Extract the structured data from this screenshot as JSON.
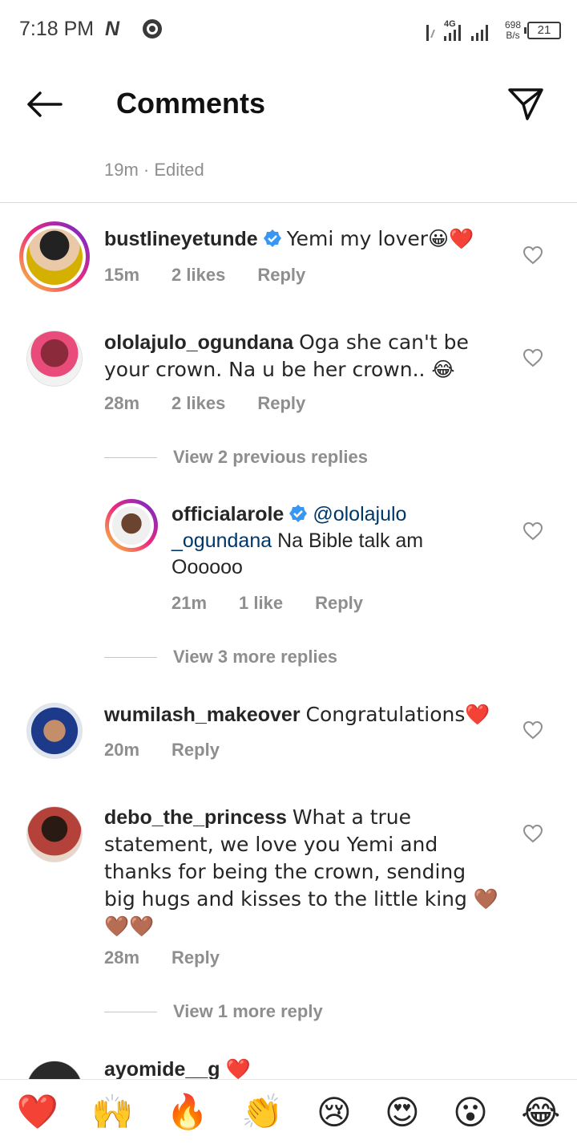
{
  "status_bar": {
    "time": "7:18 PM",
    "network": "4G",
    "speed_value": "698",
    "speed_unit": "B/s",
    "battery": "21"
  },
  "header": {
    "title": "Comments"
  },
  "caption": {
    "meta": "19m · Edited"
  },
  "comments": [
    {
      "username": "bustlineyetunde",
      "verified": true,
      "text": "Yemi my lover😀❤️",
      "time": "15m",
      "likes": "2 likes",
      "reply": "Reply"
    },
    {
      "username": "ololajulo_ogundana",
      "verified": false,
      "text": "Oga she can't be your crown. Na u be her crown.. 😂",
      "time": "28m",
      "likes": "2 likes",
      "reply": "Reply",
      "view_previous": "View 2 previous replies",
      "reply_item": {
        "username": "officialarole",
        "verified": true,
        "mention": "@ololajulo _ogundana",
        "text": "Na Bible talk am Oooooo",
        "time": "21m",
        "likes": "1 like",
        "reply": "Reply"
      },
      "view_more": "View 3 more replies"
    },
    {
      "username": "wumilash_makeover",
      "verified": false,
      "text": "Congratulations❤️",
      "time": "20m",
      "reply": "Reply"
    },
    {
      "username": "debo_the_princess",
      "verified": false,
      "text": "What a true statement, we love you Yemi and thanks for being the crown, sending big hugs and kisses to the little king 🤎🤎🤎",
      "time": "28m",
      "reply": "Reply",
      "view_more": "View 1 more reply"
    },
    {
      "username": "ayomide__g",
      "text": "❤️"
    }
  ],
  "quick_reactions": [
    "❤️",
    "🙌",
    "🔥",
    "👏",
    "😢",
    "😍",
    "😮",
    "😂"
  ],
  "colors": {
    "secondary_text": "#8e8e8e",
    "verified_blue": "#3897f0",
    "mention": "#00376b"
  }
}
